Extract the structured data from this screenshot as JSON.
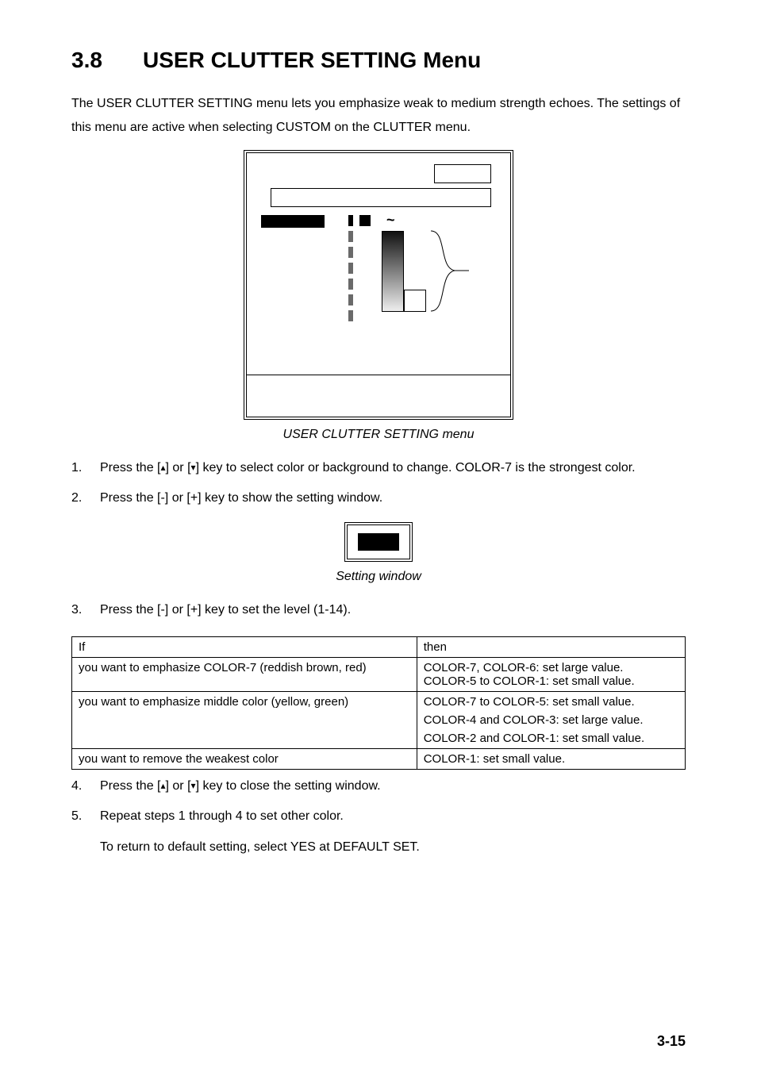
{
  "heading": {
    "number": "3.8",
    "title": "USER CLUTTER SETTING Menu"
  },
  "intro": "The USER CLUTTER SETTING menu lets you emphasize weak to medium strength echoes. The settings of this menu are active when selecting CUSTOM on the CLUTTER menu.",
  "fig1_caption": "USER CLUTTER SETTING menu",
  "tilde": "~",
  "steps": {
    "s1_num": "1.",
    "s1_a": "Press the [",
    "s1_up": "▴",
    "s1_b": "] or [",
    "s1_down": "▾",
    "s1_c": "] key to select color or background to change. COLOR-7 is the strongest color.",
    "s2_num": "2.",
    "s2": "Press the [-] or [+] key to show the setting window.",
    "s3_num": "3.",
    "s3": "Press the [-] or [+] key to set the level (1-14).",
    "s4_num": "4.",
    "s4_a": "Press the [",
    "s4_up": "▴",
    "s4_b": "] or [",
    "s4_down": "▾",
    "s4_c": "] key to close the setting window.",
    "s5_num": "5.",
    "s5": " Repeat steps 1 through 4 to set other color.",
    "s5_note": "To return to default setting, select YES at DEFAULT SET."
  },
  "fig2_caption": "Setting window",
  "table": {
    "h_if": "If",
    "h_then": "then",
    "r1_if": "you want to emphasize COLOR-7 (reddish brown, red)",
    "r1_then": "COLOR-7, COLOR-6: set large value.\nCOLOR-5 to COLOR-1: set small value.",
    "r2_if": "you want to emphasize middle color (yellow, green)",
    "r2_then_a": "COLOR-7 to COLOR-5: set small value.",
    "r2_then_b": "COLOR-4 and COLOR-3: set large value.",
    "r2_then_c": "COLOR-2 and COLOR-1: set small value.",
    "r3_if": "you want to remove the weakest color",
    "r3_then": "COLOR-1: set small value."
  },
  "page_number": "3-15"
}
